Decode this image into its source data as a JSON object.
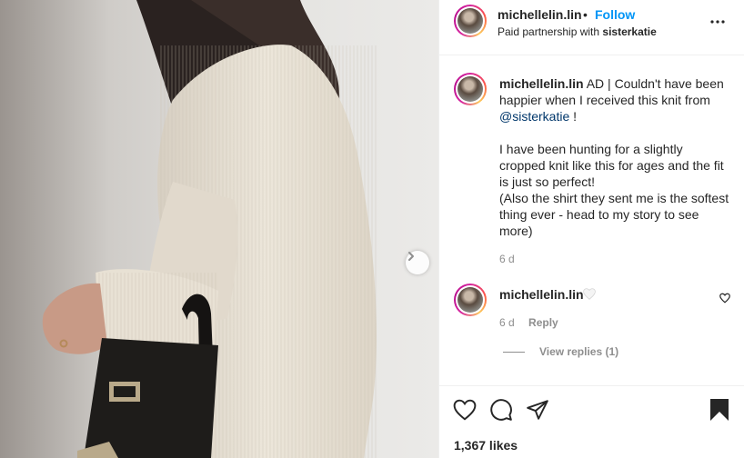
{
  "post": {
    "username": "michellelin.lin",
    "dot": "•",
    "follow_label": "Follow",
    "paid_prefix": "Paid partnership with ",
    "partner": "sisterkatie"
  },
  "caption": {
    "username": "michellelin.lin",
    "text_1": " AD | Couldn't have been happier when I received this knit from ",
    "mention": "@sisterkatie",
    "text_2": " !",
    "paragraph_2": "I have been hunting for a slightly cropped knit like this for ages and the fit is just so perfect!",
    "paragraph_3": "(Also the shirt they sent me is the softest thing ever - head to my story to see more)",
    "time": "6 d"
  },
  "comment": {
    "username": "michellelin.lin",
    "time": "6 d",
    "reply_label": "Reply",
    "view_replies": "View replies (1)"
  },
  "footer": {
    "likes": "1,367 likes"
  },
  "icons": {
    "next": "chevron-right-icon",
    "more": "more-horizontal-icon",
    "like": "heart-icon",
    "comment": "comment-icon",
    "share": "paper-plane-icon",
    "save": "bookmark-icon"
  },
  "colors": {
    "follow": "#0095f6",
    "mention": "#00376b",
    "muted": "#8e8e8e"
  }
}
